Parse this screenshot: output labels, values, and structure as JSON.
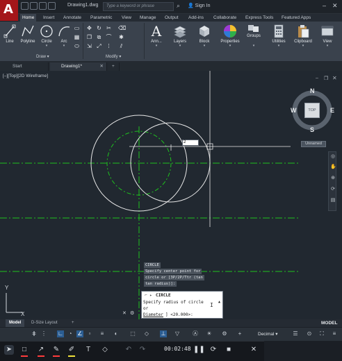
{
  "window": {
    "doc_title": "Drawing1.dwg",
    "search_placeholder": "Type a keyword or phrase",
    "signin": "Sign In"
  },
  "ribbon_tabs": [
    "Home",
    "Insert",
    "Annotate",
    "Parametric",
    "View",
    "Manage",
    "Output",
    "Add-ins",
    "Collaborate",
    "Express Tools",
    "Featured Apps"
  ],
  "ribbon": {
    "draw_tools": [
      "Line",
      "Polyline",
      "Circle",
      "Arc"
    ],
    "draw_panel": "Draw",
    "modify_panel": "Modify",
    "tools": [
      "Ann...",
      "Layers",
      "Block",
      "Properties",
      "Groups",
      "Utilities",
      "Clipboard",
      "View"
    ]
  },
  "file_tabs": [
    "Start",
    "Drawing1*"
  ],
  "viewport": {
    "label": "[–][Top][2D Wireframe]",
    "compass": {
      "n": "N",
      "s": "S",
      "e": "E",
      "w": "W",
      "top": "TOP"
    },
    "ucs_name": "Unnamed",
    "ucs_x": "X",
    "ucs_y": "Y",
    "dynamic_input": "2"
  },
  "command": {
    "history": [
      "CIRCLE",
      "Specify center point for",
      "circle or [3P/2P/Ttr (tan",
      "tan radius)]:"
    ],
    "current": "CIRCLE",
    "prompt_line1": "Specify radius of circle",
    "prompt_line2": "or",
    "option": "Diameter",
    "default": "] <20.000>:"
  },
  "layout_tabs": [
    "Model",
    "D-Size Layout"
  ],
  "status": {
    "model": "MODEL",
    "units": "Decimal"
  },
  "recorder": {
    "time": "00:02:48"
  },
  "colors": {
    "accent_red": "#a4161a",
    "centerline_green": "#1ec21e",
    "drawing_white": "#e8e8e8",
    "ribbon_bg": "#3a424d",
    "viewport_bg": "#212830"
  }
}
